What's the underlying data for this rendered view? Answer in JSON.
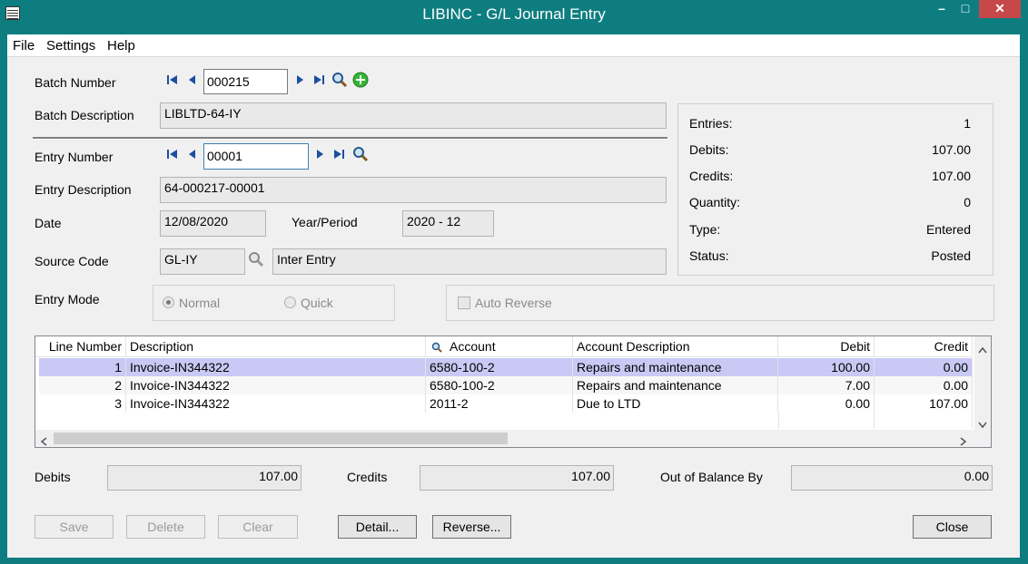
{
  "window": {
    "title": "LIBINC - G/L Journal Entry",
    "minimize": "–",
    "maximize": "□",
    "close": "✕"
  },
  "menu": {
    "file": "File",
    "settings": "Settings",
    "help": "Help"
  },
  "batch": {
    "number_label": "Batch Number",
    "number_value": "000215",
    "description_label": "Batch Description",
    "description_value": "LIBLTD-64-IY"
  },
  "entry": {
    "number_label": "Entry Number",
    "number_value": "00001",
    "description_label": "Entry Description",
    "description_value": "64-000217-00001",
    "date_label": "Date",
    "date_value": "12/08/2020",
    "year_period_label": "Year/Period",
    "year_period_value": "2020 - 12",
    "source_code_label": "Source Code",
    "source_code_value": "GL-IY",
    "source_code_desc": "Inter Entry",
    "entry_mode_label": "Entry Mode",
    "mode_normal": "Normal",
    "mode_quick": "Quick",
    "auto_reverse": "Auto Reverse"
  },
  "stats": {
    "entries_label": "Entries:",
    "entries_value": "1",
    "debits_label": "Debits:",
    "debits_value": "107.00",
    "credits_label": "Credits:",
    "credits_value": "107.00",
    "quantity_label": "Quantity:",
    "quantity_value": "0",
    "type_label": "Type:",
    "type_value": "Entered",
    "status_label": "Status:",
    "status_value": "Posted"
  },
  "grid": {
    "columns": {
      "line": "Line Number",
      "description": "Description",
      "account": "Account",
      "account_description": "Account Description",
      "debit": "Debit",
      "credit": "Credit"
    },
    "rows": [
      {
        "line": "1",
        "description": "Invoice-IN344322",
        "account": "6580-100-2",
        "account_description": "Repairs and maintenance",
        "debit": "100.00",
        "credit": "0.00"
      },
      {
        "line": "2",
        "description": "Invoice-IN344322",
        "account": "6580-100-2",
        "account_description": "Repairs and maintenance",
        "debit": "7.00",
        "credit": "0.00"
      },
      {
        "line": "3",
        "description": "Invoice-IN344322",
        "account": "2011-2",
        "account_description": "Due to LTD",
        "debit": "0.00",
        "credit": "107.00"
      }
    ]
  },
  "totals": {
    "debits_label": "Debits",
    "debits_value": "107.00",
    "credits_label": "Credits",
    "credits_value": "107.00",
    "out_of_balance_label": "Out of Balance By",
    "out_of_balance_value": "0.00"
  },
  "buttons": {
    "save": "Save",
    "delete": "Delete",
    "clear": "Clear",
    "detail": "Detail...",
    "reverse": "Reverse...",
    "close": "Close"
  },
  "colors": {
    "title_bar": "#0e7d80",
    "selected_row": "#c9c9f5"
  }
}
